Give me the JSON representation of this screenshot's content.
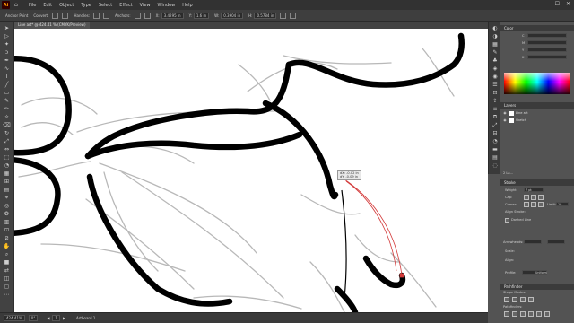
{
  "menubar": {
    "logo": "Ai",
    "items": [
      "File",
      "Edit",
      "Object",
      "Type",
      "Select",
      "Effect",
      "View",
      "Window",
      "Help"
    ],
    "window_buttons": [
      "–",
      "☐",
      "✕"
    ]
  },
  "controlbar": {
    "anchor_label": "Anchor Point",
    "convert_label": "Convert:",
    "handles_label": "Handles:",
    "anchors_label": "Anchors:",
    "x_label": "X:",
    "x_value": "3.4295 in",
    "y_label": "Y:",
    "y_value": "1.6 in",
    "w_label": "W:",
    "w_value": "0.3904 in",
    "h_label": "H:",
    "h_value": "0.5784 in"
  },
  "document": {
    "tab_title": "Line art* @ 424.41 % (CMYK/Preview)"
  },
  "canvas": {
    "tooltip_lines": [
      "dX: -0.02 in",
      "dY: -0.09 in"
    ]
  },
  "statusbar": {
    "zoom": "424.41%",
    "angle": "0°",
    "artboard_nav": "1",
    "artboard_label": "Artboard 1"
  },
  "panels": {
    "color": {
      "title": "Color",
      "channels": [
        "C",
        "M",
        "Y",
        "K"
      ]
    },
    "layers": {
      "title": "Layers",
      "rows": [
        {
          "name": "Line art"
        },
        {
          "name": "Sketch"
        }
      ],
      "footer": "2 La..."
    },
    "stroke": {
      "title": "Stroke",
      "weight_label": "Weight:",
      "weight_value": "7 pt",
      "cap_label": "Cap:",
      "corner_label": "Corner:",
      "limit_label": "Limit:",
      "limit_value": "10",
      "align_label": "Align Stroke:",
      "dashed_label": "Dashed Line",
      "arrowheads_label": "Arrowheads:",
      "scale_label": "Scale:",
      "align2_label": "Align:",
      "profile_label": "Profile:",
      "profile_value": "Uniform"
    },
    "pathfinder": {
      "title": "Pathfinder",
      "shape_modes_label": "Shape Modes:",
      "pathfinders_label": "Pathfinders:"
    }
  },
  "colors": {
    "ui_dark": "#323232",
    "ui_mid": "#535353",
    "canvas": "#ffffff",
    "ink": "#000000",
    "sketch": "#b8b8b8",
    "selection": "#d33a3a"
  }
}
